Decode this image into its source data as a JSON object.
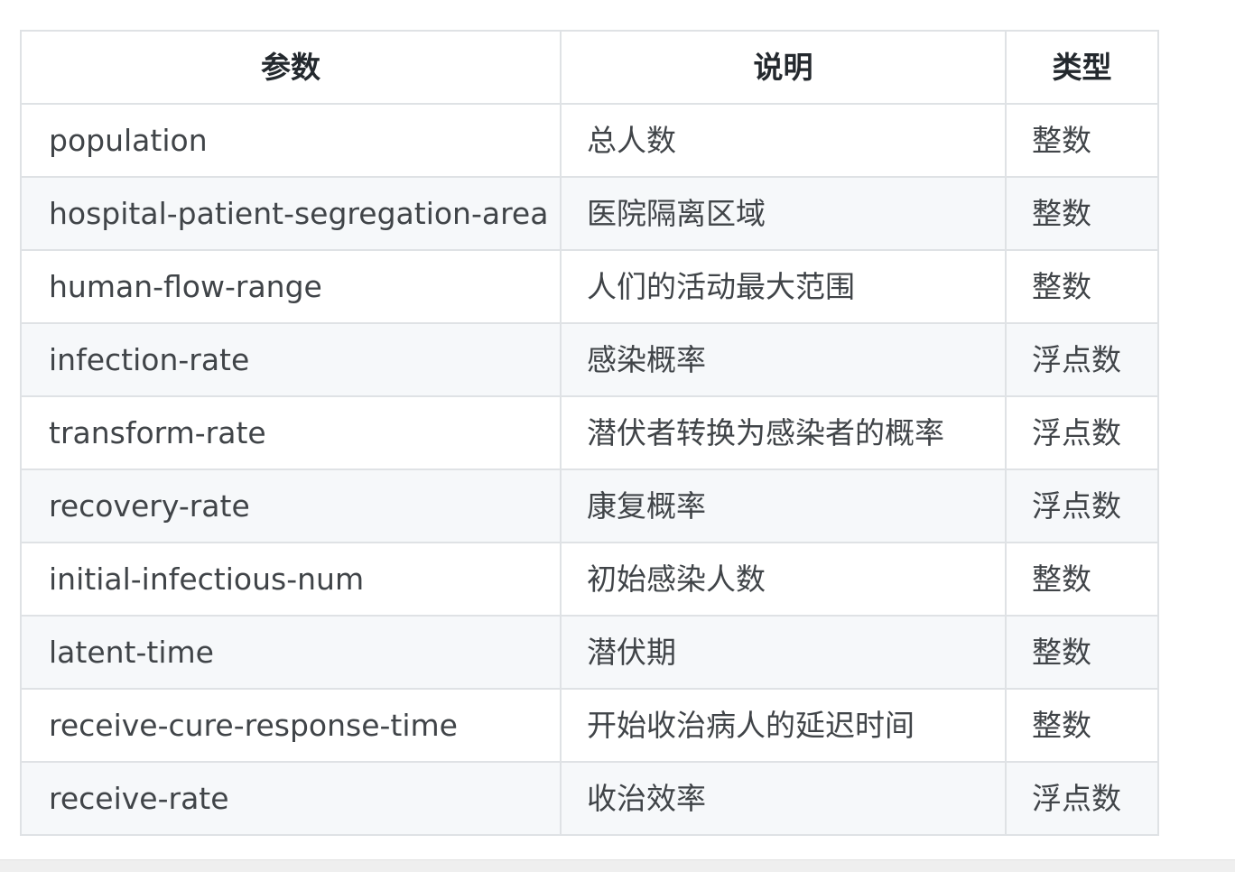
{
  "table": {
    "headers": {
      "param": "参数",
      "description": "说明",
      "type": "类型"
    },
    "rows": [
      {
        "param": "population",
        "description": "总人数",
        "type": "整数"
      },
      {
        "param": "hospital-patient-segregation-area",
        "description": "医院隔离区域",
        "type": "整数"
      },
      {
        "param": "human-flow-range",
        "description": "人们的活动最大范围",
        "type": "整数"
      },
      {
        "param": "infection-rate",
        "description": "感染概率",
        "type": "浮点数"
      },
      {
        "param": "transform-rate",
        "description": "潜伏者转换为感染者的概率",
        "type": "浮点数"
      },
      {
        "param": "recovery-rate",
        "description": "康复概率",
        "type": "浮点数"
      },
      {
        "param": "initial-infectious-num",
        "description": "初始感染人数",
        "type": "整数"
      },
      {
        "param": "latent-time",
        "description": "潜伏期",
        "type": "整数"
      },
      {
        "param": "receive-cure-response-time",
        "description": "开始收治病人的延迟时间",
        "type": "整数"
      },
      {
        "param": "receive-rate",
        "description": "收治效率",
        "type": "浮点数"
      }
    ]
  },
  "colors": {
    "border": "#dfe2e5",
    "stripe": "#f6f8fa",
    "header_text": "#24292e",
    "cell_text": "#404448"
  }
}
